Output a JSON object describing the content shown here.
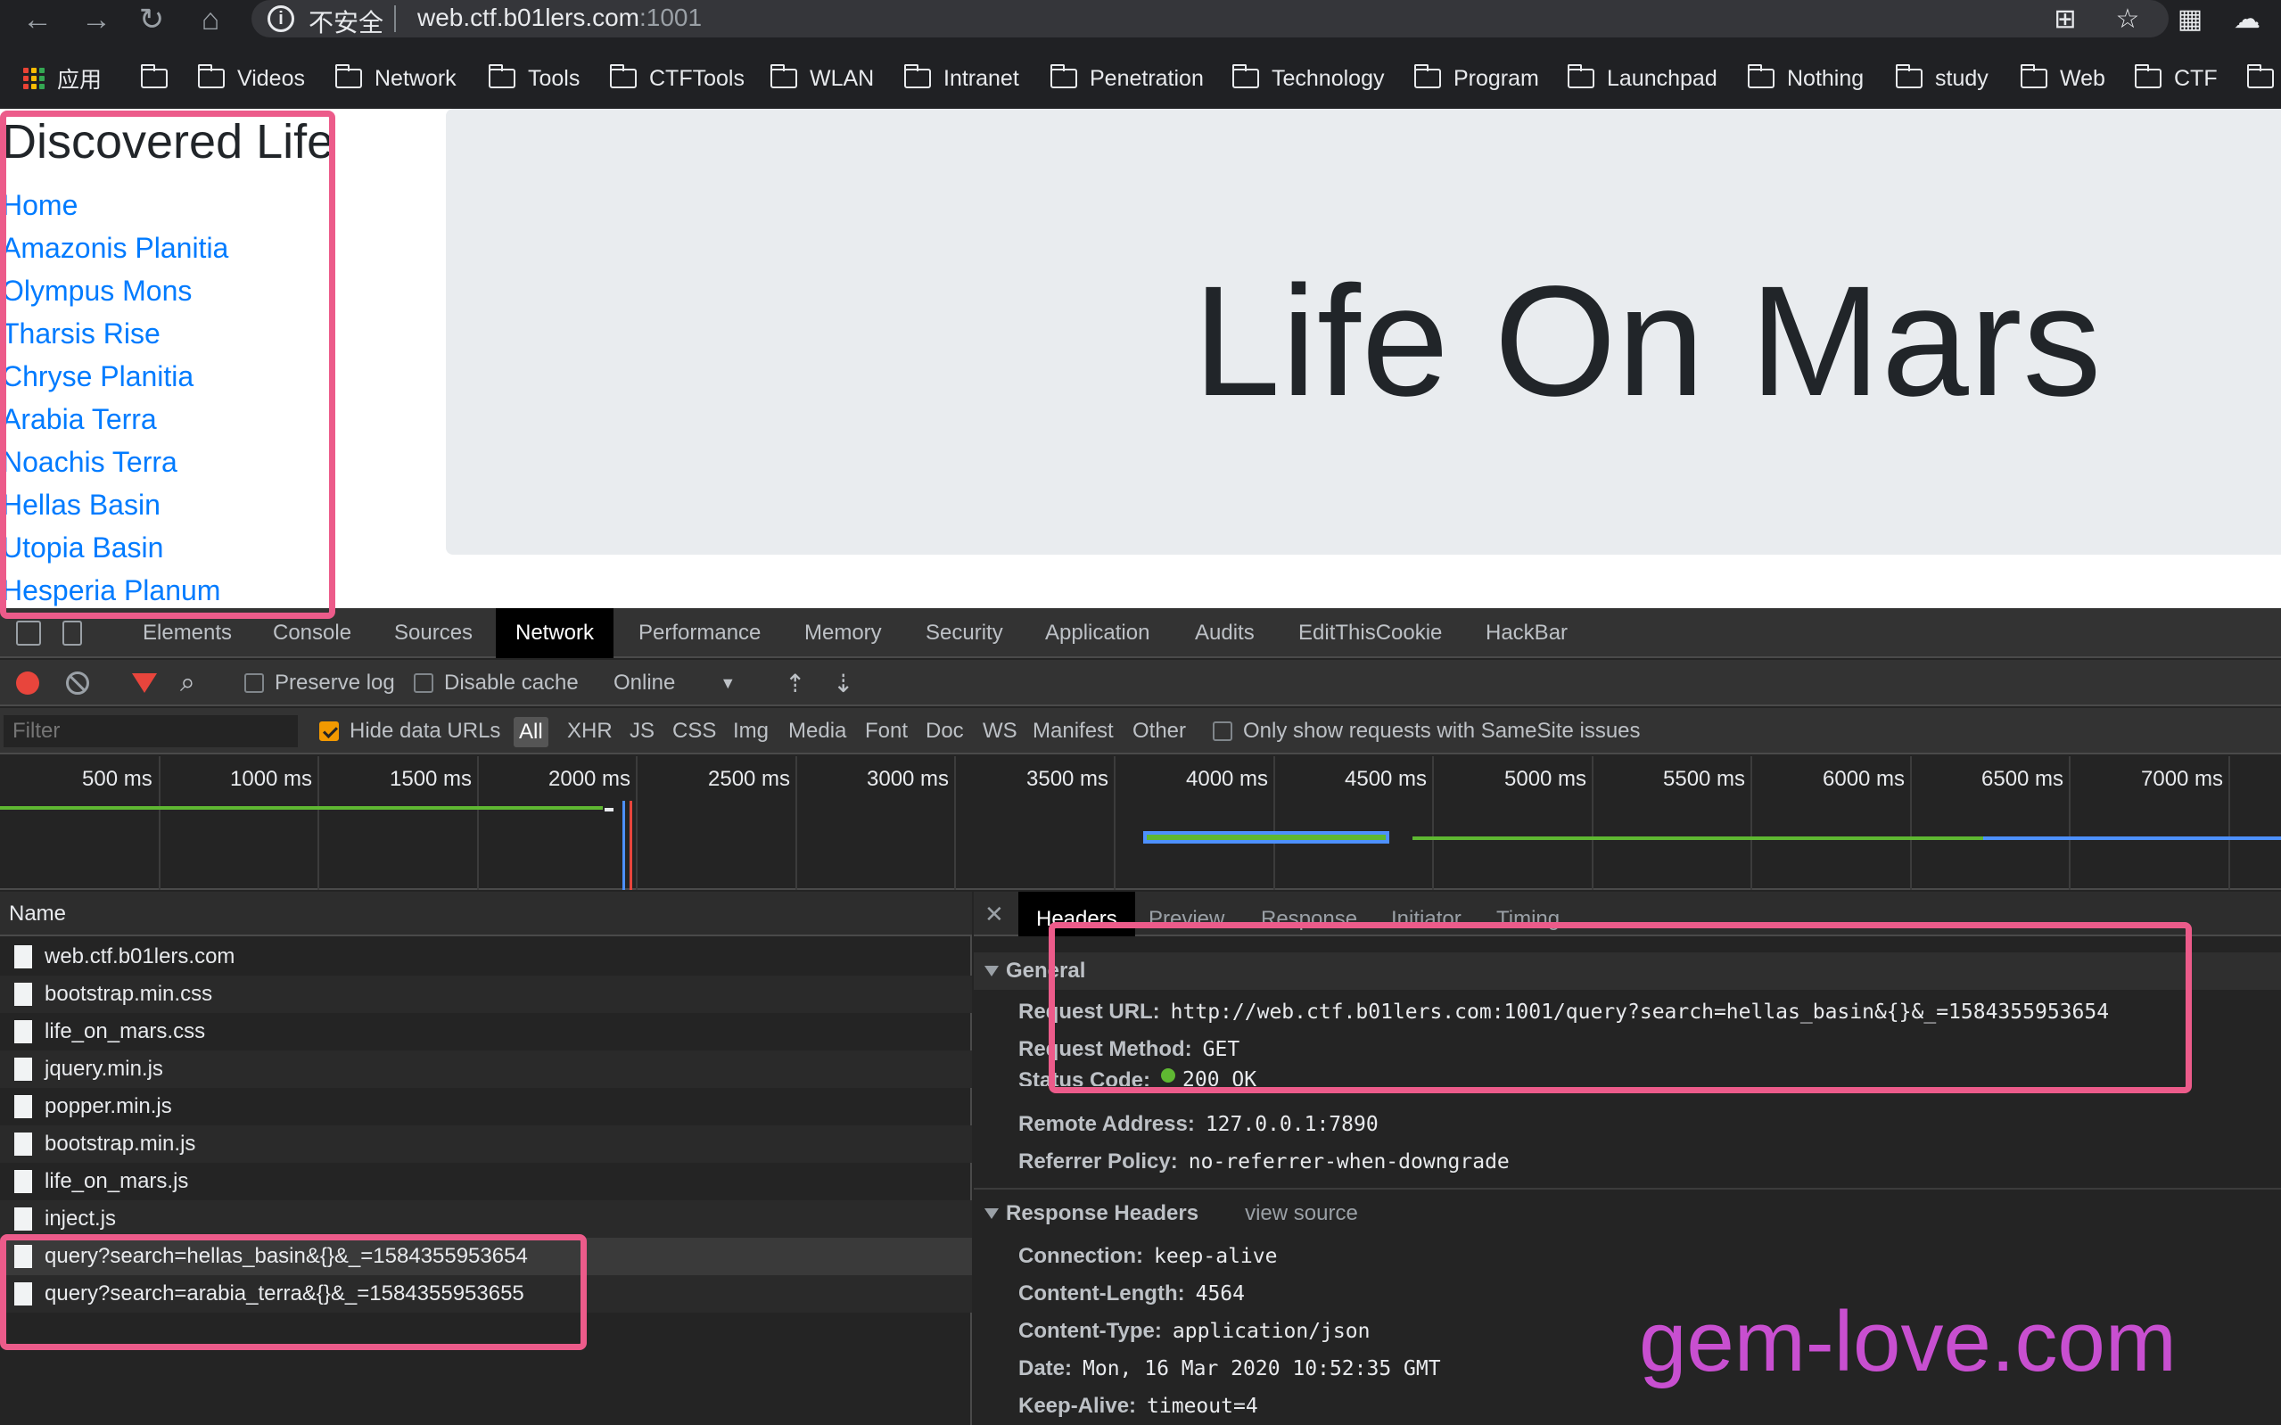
{
  "browser": {
    "security_label": "不安全",
    "url_host": "web.ctf.b01lers.com",
    "url_port": ":1001",
    "bookmarks": [
      {
        "label": "应用"
      },
      {
        "label": ""
      },
      {
        "label": "Videos"
      },
      {
        "label": "Network"
      },
      {
        "label": "Tools"
      },
      {
        "label": "CTFTools"
      },
      {
        "label": "WLAN"
      },
      {
        "label": "Intranet"
      },
      {
        "label": "Penetration"
      },
      {
        "label": "Technology"
      },
      {
        "label": "Program"
      },
      {
        "label": "Launchpad"
      },
      {
        "label": "Nothing"
      },
      {
        "label": "study"
      },
      {
        "label": "Web"
      },
      {
        "label": "CTF"
      }
    ]
  },
  "page": {
    "site_title": "Discovered Life",
    "nav_links": [
      "Home",
      "Amazonis Planitia",
      "Olympus Mons",
      "Tharsis Rise",
      "Chryse Planitia",
      "Arabia Terra",
      "Noachis Terra",
      "Hellas Basin",
      "Utopia Basin",
      "Hesperia Planum"
    ],
    "jumbotron_title": "Life On Mars"
  },
  "devtools": {
    "tabs": [
      "Elements",
      "Console",
      "Sources",
      "Network",
      "Performance",
      "Memory",
      "Security",
      "Application",
      "Audits",
      "EditThisCookie",
      "HackBar"
    ],
    "active_tab": "Network",
    "toolbar": {
      "preserve_log": "Preserve log",
      "disable_cache": "Disable cache",
      "throttle": "Online"
    },
    "filterbar": {
      "placeholder": "Filter",
      "hide_data_urls": "Hide data URLs",
      "types": [
        "All",
        "XHR",
        "JS",
        "CSS",
        "Img",
        "Media",
        "Font",
        "Doc",
        "WS",
        "Manifest",
        "Other"
      ],
      "samesite": "Only show requests with SameSite issues"
    },
    "timeline_ticks": [
      "500 ms",
      "1000 ms",
      "1500 ms",
      "2000 ms",
      "2500 ms",
      "3000 ms",
      "3500 ms",
      "4000 ms",
      "4500 ms",
      "5000 ms",
      "5500 ms",
      "6000 ms",
      "6500 ms",
      "7000 ms"
    ],
    "name_column": "Name",
    "requests": [
      "web.ctf.b01lers.com",
      "bootstrap.min.css",
      "life_on_mars.css",
      "jquery.min.js",
      "popper.min.js",
      "bootstrap.min.js",
      "life_on_mars.js",
      "inject.js",
      "query?search=hellas_basin&{}&_=1584355953654",
      "query?search=arabia_terra&{}&_=1584355953655"
    ],
    "detail_tabs": [
      "Headers",
      "Preview",
      "Response",
      "Initiator",
      "Timing"
    ],
    "general": {
      "title": "General",
      "request_url_key": "Request URL:",
      "request_url": "http://web.ctf.b01lers.com:1001/query?search=hellas_basin&{}&_=1584355953654",
      "request_method_key": "Request Method:",
      "request_method": "GET",
      "status_code_key": "Status Code:",
      "status_code": "200 OK",
      "remote_address_key": "Remote Address:",
      "remote_address": "127.0.0.1:7890",
      "referrer_policy_key": "Referrer Policy:",
      "referrer_policy": "no-referrer-when-downgrade"
    },
    "response_headers": {
      "title": "Response Headers",
      "view_source": "view source",
      "items": [
        {
          "k": "Connection:",
          "v": "keep-alive"
        },
        {
          "k": "Content-Length:",
          "v": "4564"
        },
        {
          "k": "Content-Type:",
          "v": "application/json"
        },
        {
          "k": "Date:",
          "v": "Mon, 16 Mar 2020 10:52:35 GMT"
        },
        {
          "k": "Keep-Alive:",
          "v": "timeout=4"
        }
      ]
    }
  },
  "watermark": "gem-love.com",
  "colors": {
    "highlight": "#ec5b8a",
    "link": "#007bff",
    "devtools_bg": "#242424"
  }
}
